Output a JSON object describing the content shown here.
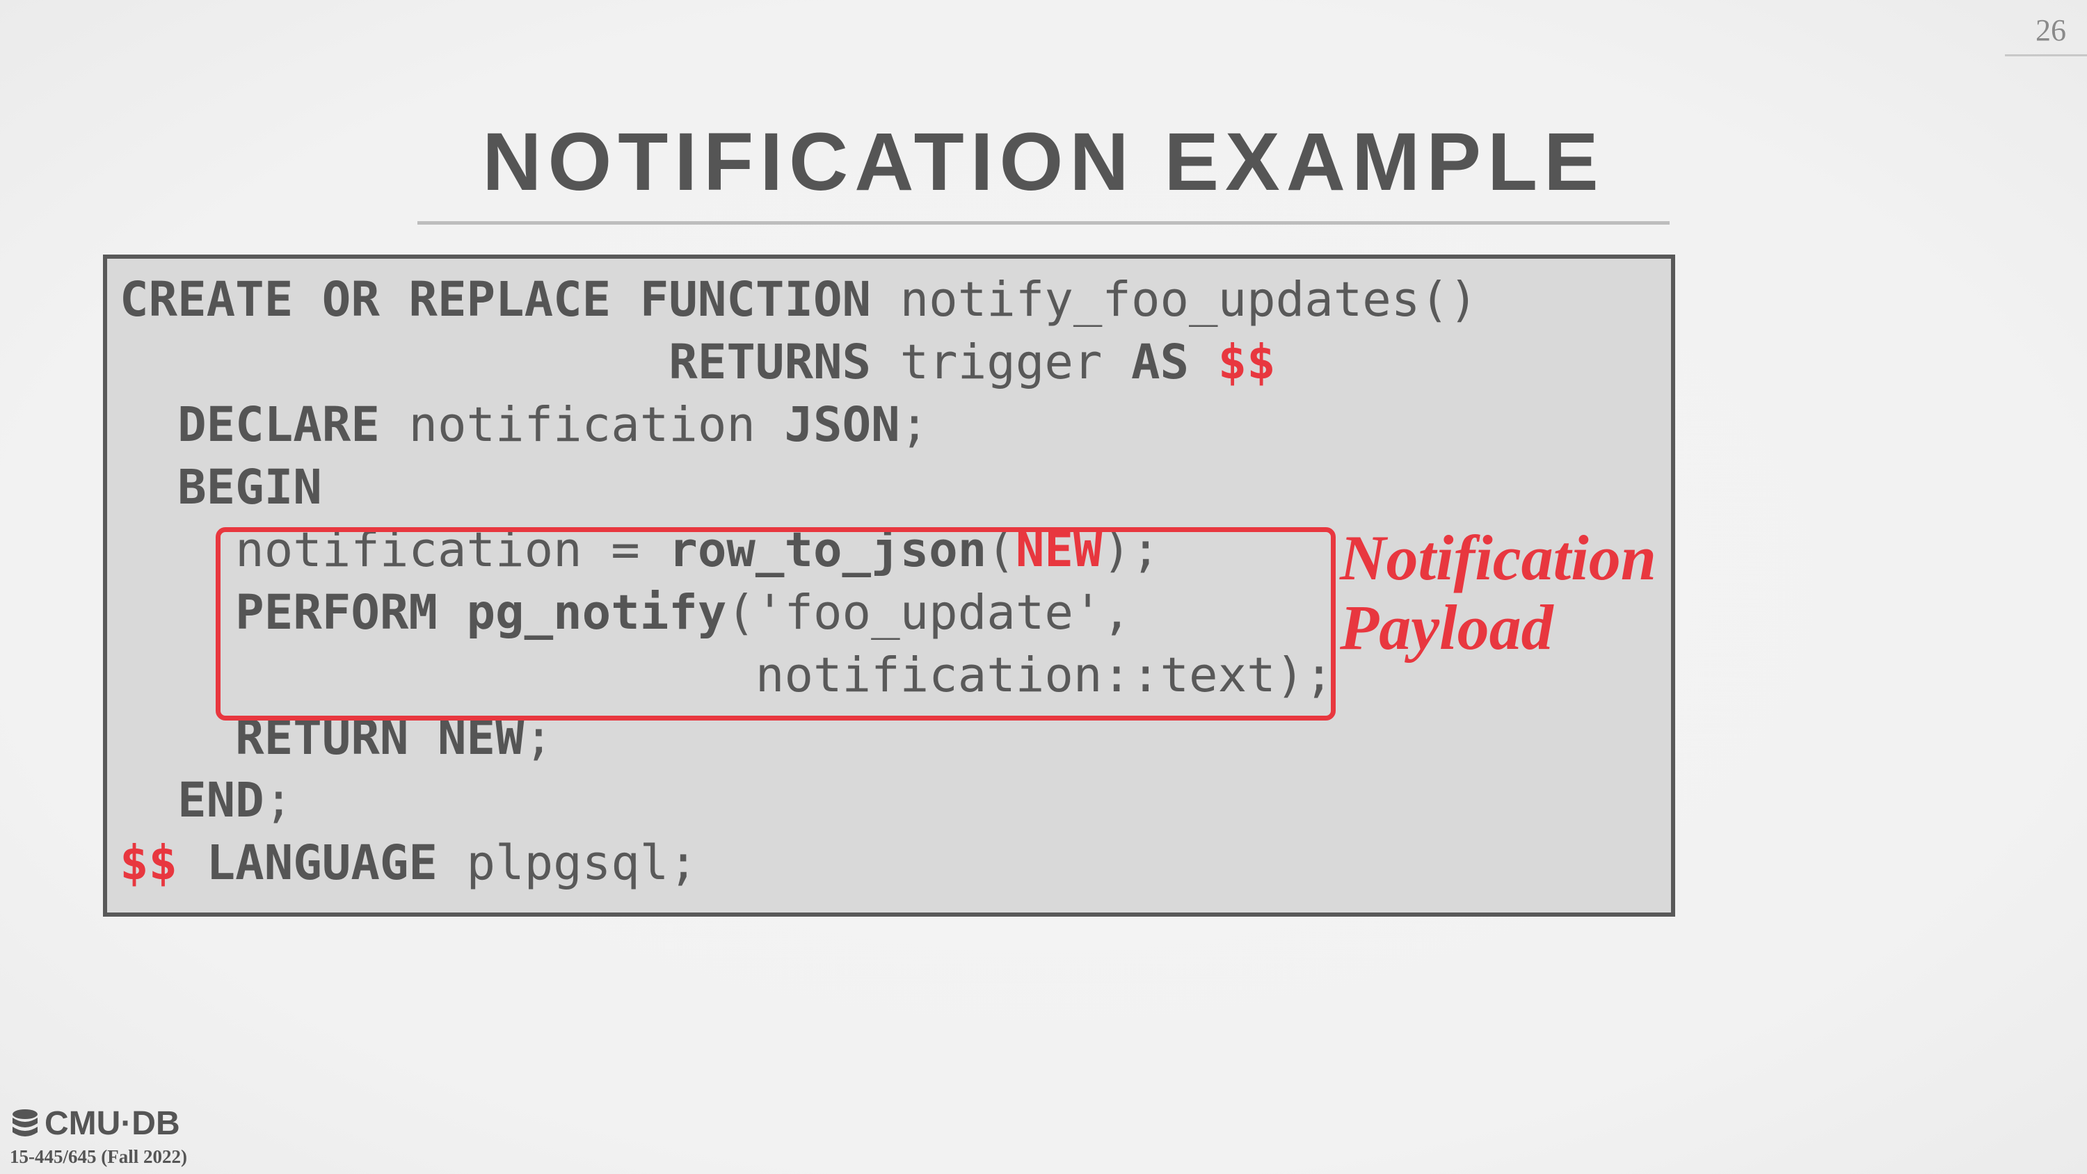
{
  "slide": {
    "page_number": "26",
    "title": "NOTIFICATION EXAMPLE"
  },
  "code": {
    "line1": {
      "kw": "CREATE OR REPLACE FUNCTION",
      "rest": "notify_foo_updates()"
    },
    "line2": {
      "kw1": "RETURNS",
      "mid": "trigger",
      "kw2": "AS",
      "dollar": "$$"
    },
    "line3": {
      "kw1": "DECLARE",
      "mid": "notification",
      "kw2": "JSON",
      "end": ";"
    },
    "line4": {
      "kw": "BEGIN"
    },
    "line5": {
      "pre": "notification = ",
      "fn": "row_to_json",
      "open": "(",
      "new": "NEW",
      "close": ");"
    },
    "line6": {
      "kw": "PERFORM",
      "fn": "pg_notify",
      "rest": "('foo_update',"
    },
    "line7": {
      "rest": "notification::text);"
    },
    "line8": {
      "kw": "RETURN NEW",
      "end": ";"
    },
    "line9": {
      "kw": "END",
      "end": ";"
    },
    "line10": {
      "dollar": "$$",
      "kw": "LANGUAGE",
      "rest": "plpgsql;"
    }
  },
  "annotation": {
    "line1": "Notification",
    "line2": "Payload"
  },
  "footer": {
    "logo_text": "CMU·DB",
    "logo_icon": "database-icon",
    "course": "15-445/645 (Fall 2022)"
  },
  "colors": {
    "accent_red": "#e8373f",
    "text_gray": "#555555",
    "code_bg": "#d9d9d9"
  }
}
